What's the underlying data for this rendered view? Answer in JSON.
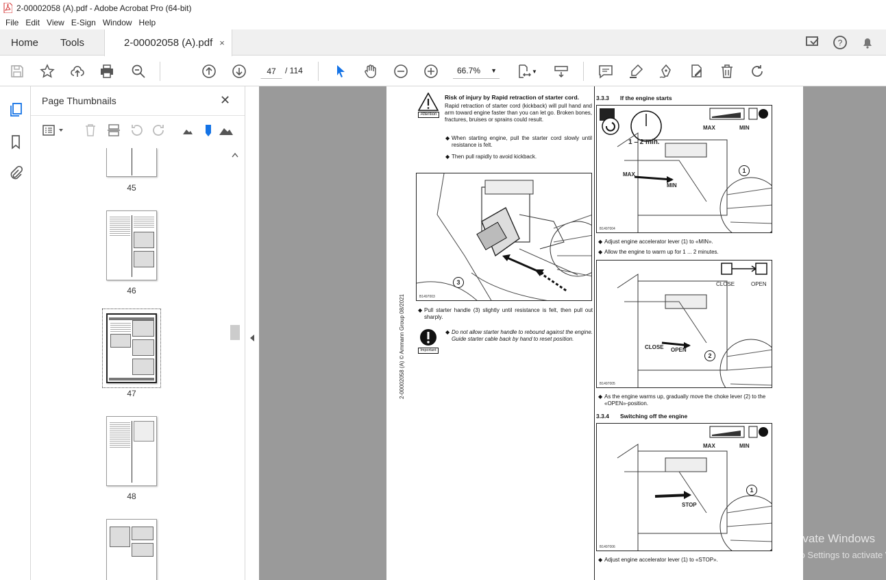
{
  "window": {
    "title": "2-00002058 (A).pdf - Adobe Acrobat Pro (64-bit)"
  },
  "menu": [
    "File",
    "Edit",
    "View",
    "E-Sign",
    "Window",
    "Help"
  ],
  "tabs": {
    "home": "Home",
    "tools": "Tools",
    "document": "2-00002058 (A).pdf",
    "close": "×"
  },
  "toolbar": {
    "current_page": "47",
    "total_pages": "/  114",
    "zoom": "66.7%"
  },
  "thumbnails": {
    "title": "Page Thumbnails",
    "close": "✕",
    "pages": [
      "45",
      "46",
      "47",
      "48"
    ]
  },
  "page": {
    "side_text": "2-00002058 (A) © Ammann Group  08/2021",
    "warning": {
      "icon_label": "Attention",
      "title": "Risk of injury by Rapid retraction of starter cord.",
      "body": "Rapid retraction of starter cord (kickback) will pull hand and arm toward engine faster than you can let go. Broken bones, fractures, bruises or sprains could result.",
      "bullet1": "When starting engine, pull the starter cord slowly until resistance is felt.",
      "bullet2": "Then pull rapidly to avoid kickback."
    },
    "fig1": {
      "code": "B1497003",
      "callout": "3"
    },
    "instruction1": "Pull starter handle (3) slightly until resistance is felt, then pull out sharply.",
    "important": {
      "icon_label": "Important",
      "text": "Do not allow starter handle to rebound against the engine. Guide starter cable back by hand to reset position."
    },
    "section1": {
      "number": "3.3.3",
      "title": "If the engine starts"
    },
    "fig2": {
      "code": "B1497004",
      "max": "MAX",
      "min": "MIN",
      "time": "1 – 2 min.",
      "max2": "MAX",
      "min2": "MIN",
      "callout": "1"
    },
    "step1": "Adjust engine accelerator lever (1) to «MIN».",
    "step2": "Allow the engine to warm up for 1 ... 2 minutes.",
    "fig3": {
      "code": "B1497005",
      "close": "CLOSE",
      "open": "OPEN",
      "close2": "CLOSE",
      "open2": "OPEN",
      "callout": "2"
    },
    "step3": "As the engine warms up, gradually move the choke lever (2) to the «OPEN»-position.",
    "section2": {
      "number": "3.3.4",
      "title": "Switching off the engine"
    },
    "fig4": {
      "code": "B1497006",
      "max": "MAX",
      "min": "MIN",
      "stop": "STOP",
      "callout": "1"
    },
    "step4": "Adjust engine accelerator lever (1) to «STOP»."
  },
  "watermark": {
    "line1": "Activate Windows",
    "line2": "Go to Settings to activate Windows."
  }
}
